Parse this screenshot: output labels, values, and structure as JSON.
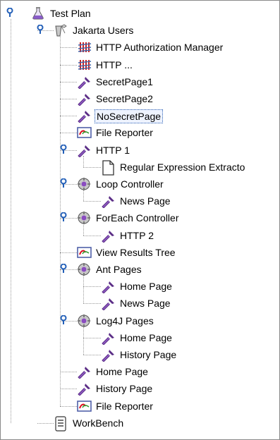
{
  "tree": {
    "nodes": [
      {
        "label": "Test Plan",
        "icon": "flask-icon",
        "level": 0,
        "toggle": "collapse"
      },
      {
        "label": "Jakarta Users",
        "icon": "thread-group-icon",
        "level": 1,
        "toggle": "collapse"
      },
      {
        "label": "HTTP Authorization Manager",
        "icon": "config-element-icon",
        "level": 2
      },
      {
        "label": "HTTP ...",
        "icon": "config-element-icon",
        "level": 2
      },
      {
        "label": "SecretPage1",
        "icon": "sampler-pipette-icon",
        "level": 2
      },
      {
        "label": "SecretPage2",
        "icon": "sampler-pipette-icon",
        "level": 2
      },
      {
        "label": "NoSecretPage",
        "icon": "sampler-pipette-icon",
        "level": 2,
        "selected": true
      },
      {
        "label": "File Reporter",
        "icon": "listener-icon",
        "level": 2
      },
      {
        "label": "HTTP 1",
        "icon": "sampler-pipette-icon",
        "level": 2,
        "toggle": "collapse"
      },
      {
        "label": "Regular Expression Extracto",
        "icon": "document-icon",
        "level": 3
      },
      {
        "label": "Loop Controller",
        "icon": "controller-gear-icon",
        "level": 2,
        "toggle": "collapse"
      },
      {
        "label": "News Page",
        "icon": "sampler-pipette-icon",
        "level": 3
      },
      {
        "label": "ForEach Controller",
        "icon": "controller-gear-icon",
        "level": 2,
        "toggle": "collapse"
      },
      {
        "label": "HTTP 2",
        "icon": "sampler-pipette-icon",
        "level": 3
      },
      {
        "label": "View Results Tree",
        "icon": "listener-icon",
        "level": 2
      },
      {
        "label": "Ant Pages",
        "icon": "controller-gear-icon",
        "level": 2,
        "toggle": "collapse"
      },
      {
        "label": "Home Page",
        "icon": "sampler-pipette-icon",
        "level": 3
      },
      {
        "label": "News Page",
        "icon": "sampler-pipette-icon",
        "level": 3
      },
      {
        "label": "Log4J Pages",
        "icon": "controller-gear-icon",
        "level": 2,
        "toggle": "collapse"
      },
      {
        "label": "Home Page",
        "icon": "sampler-pipette-icon",
        "level": 3
      },
      {
        "label": "History Page",
        "icon": "sampler-pipette-icon",
        "level": 3
      },
      {
        "label": "Home Page",
        "icon": "sampler-pipette-icon",
        "level": 2
      },
      {
        "label": "History Page",
        "icon": "sampler-pipette-icon",
        "level": 2
      },
      {
        "label": "File Reporter",
        "icon": "listener-icon",
        "level": 2
      },
      {
        "label": "WorkBench",
        "icon": "workbench-icon",
        "level": 1
      }
    ]
  },
  "colors": {
    "toggle_blue": "#2460b8",
    "pipette_purple": "#7a2ea0",
    "selection_border": "#2a5fb3",
    "guide_line": "#9a9a9a"
  }
}
